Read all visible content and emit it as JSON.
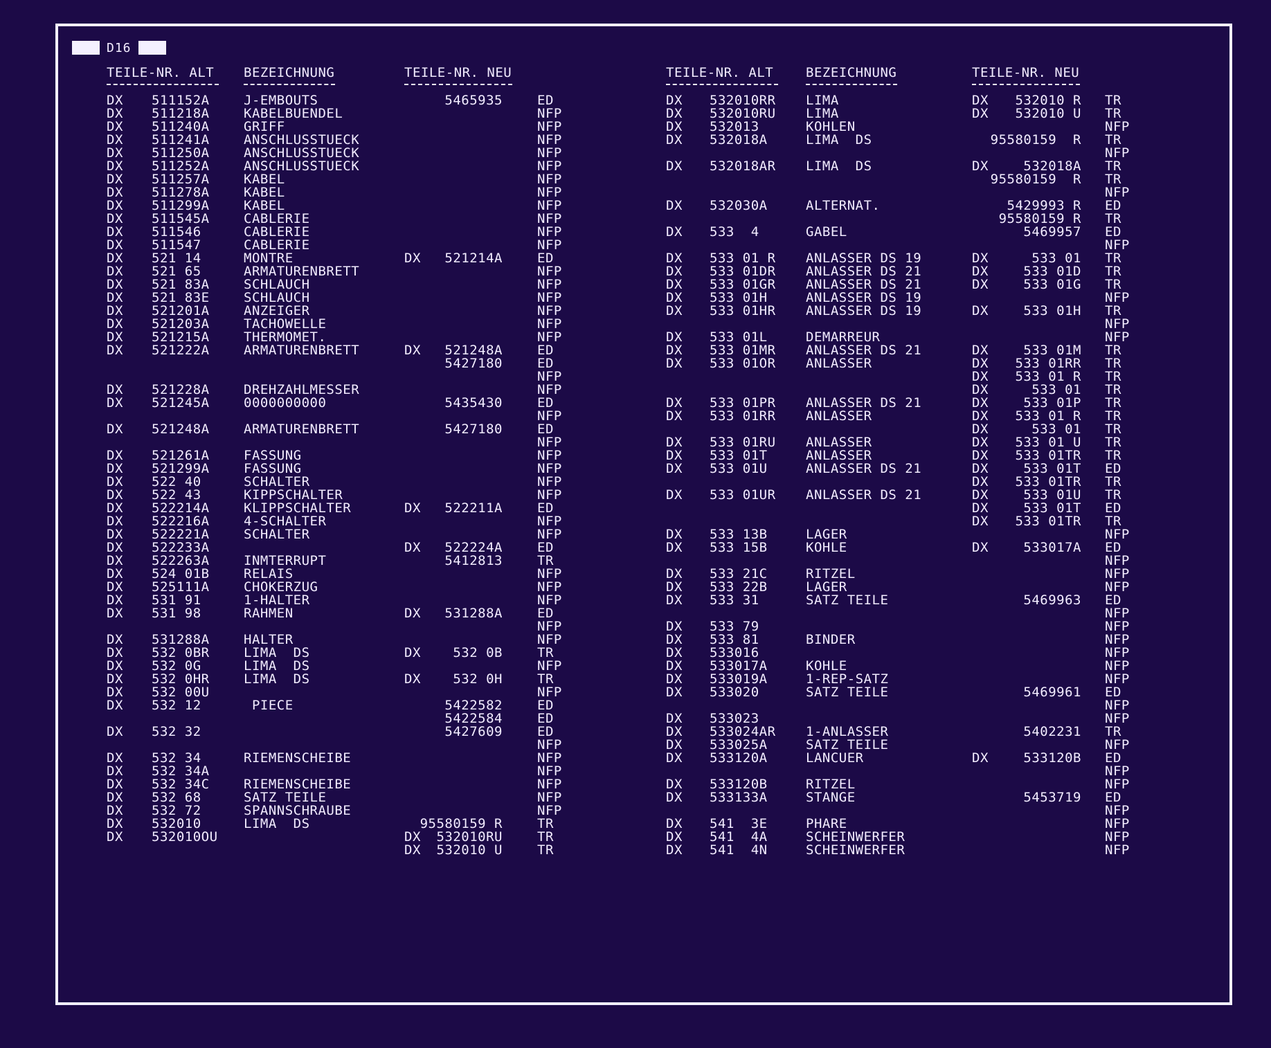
{
  "sheet_code": "D16",
  "headers": {
    "left": {
      "alt": "TEILE-NR. ALT",
      "bez": "BEZEICHNUNG",
      "neu": "TEILE-NR. NEU"
    },
    "right": {
      "alt": "TEILE-NR. ALT",
      "bez": "BEZEICHNUNG",
      "neu": "TEILE-NR. NEU"
    }
  },
  "left_rows": [
    [
      "DX",
      "511152A",
      "J-EMBOUTS",
      "",
      "5465935",
      "ED"
    ],
    [
      "DX",
      "511218A",
      "KABELBUENDEL",
      "",
      "",
      "NFP"
    ],
    [
      "DX",
      "511240A",
      "GRIFF",
      "",
      "",
      "NFP"
    ],
    [
      "DX",
      "511241A",
      "ANSCHLUSSTUECK",
      "",
      "",
      "NFP"
    ],
    [
      "DX",
      "511250A",
      "ANSCHLUSSTUECK",
      "",
      "",
      "NFP"
    ],
    [
      "DX",
      "511252A",
      "ANSCHLUSSTUECK",
      "",
      "",
      "NFP"
    ],
    [
      "DX",
      "511257A",
      "KABEL",
      "",
      "",
      "NFP"
    ],
    [
      "DX",
      "511278A",
      "KABEL",
      "",
      "",
      "NFP"
    ],
    [
      "DX",
      "511299A",
      "KABEL",
      "",
      "",
      "NFP"
    ],
    [
      "DX",
      "511545A",
      "CABLERIE",
      "",
      "",
      "NFP"
    ],
    [
      "DX",
      "511546",
      "CABLERIE",
      "",
      "",
      "NFP"
    ],
    [
      "DX",
      "511547",
      "CABLERIE",
      "",
      "",
      "NFP"
    ],
    [
      "DX",
      "521 14",
      "MONTRE",
      "DX",
      "521214A",
      "ED"
    ],
    [
      "DX",
      "521 65",
      "ARMATURENBRETT",
      "",
      "",
      "NFP"
    ],
    [
      "DX",
      "521 83A",
      "SCHLAUCH",
      "",
      "",
      "NFP"
    ],
    [
      "DX",
      "521 83E",
      "SCHLAUCH",
      "",
      "",
      "NFP"
    ],
    [
      "DX",
      "521201A",
      "ANZEIGER",
      "",
      "",
      "NFP"
    ],
    [
      "DX",
      "521203A",
      "TACHOWELLE",
      "",
      "",
      "NFP"
    ],
    [
      "DX",
      "521215A",
      "THERMOMET.",
      "",
      "",
      "NFP"
    ],
    [
      "DX",
      "521222A",
      "ARMATURENBRETT",
      "DX",
      "521248A",
      "ED"
    ],
    [
      "",
      "",
      "",
      "",
      "5427180",
      "ED"
    ],
    [
      "",
      "",
      "",
      "",
      "",
      "NFP"
    ],
    [
      "DX",
      "521228A",
      "DREHZAHLMESSER",
      "",
      "",
      "NFP"
    ],
    [
      "DX",
      "521245A",
      "0000000000",
      "",
      "5435430",
      "ED"
    ],
    [
      "",
      "",
      "",
      "",
      "",
      "NFP"
    ],
    [
      "DX",
      "521248A",
      "ARMATURENBRETT",
      "",
      "5427180",
      "ED"
    ],
    [
      "",
      "",
      "",
      "",
      "",
      "NFP"
    ],
    [
      "DX",
      "521261A",
      "FASSUNG",
      "",
      "",
      "NFP"
    ],
    [
      "DX",
      "521299A",
      "FASSUNG",
      "",
      "",
      "NFP"
    ],
    [
      "DX",
      "522 40",
      "SCHALTER",
      "",
      "",
      "NFP"
    ],
    [
      "DX",
      "522 43",
      "KIPPSCHALTER",
      "",
      "",
      "NFP"
    ],
    [
      "DX",
      "522214A",
      "KLIPPSCHALTER",
      "DX",
      "522211A",
      "ED"
    ],
    [
      "DX",
      "522216A",
      "4-SCHALTER",
      "",
      "",
      "NFP"
    ],
    [
      "DX",
      "522221A",
      "SCHALTER",
      "",
      "",
      "NFP"
    ],
    [
      "DX",
      "522233A",
      "",
      "DX",
      "522224A",
      "ED"
    ],
    [
      "DX",
      "522263A",
      "INMTERRUPT",
      "",
      "5412813",
      "TR"
    ],
    [
      "DX",
      "524 01B",
      "RELAIS",
      "",
      "",
      "NFP"
    ],
    [
      "DX",
      "525111A",
      "CHOKERZUG",
      "",
      "",
      "NFP"
    ],
    [
      "DX",
      "531 91",
      "1-HALTER",
      "",
      "",
      "NFP"
    ],
    [
      "DX",
      "531 98",
      "RAHMEN",
      "DX",
      "531288A",
      "ED"
    ],
    [
      "",
      "",
      "",
      "",
      "",
      "NFP"
    ],
    [
      "DX",
      "531288A",
      "HALTER",
      "",
      "",
      "NFP"
    ],
    [
      "DX",
      "532 0BR",
      "LIMA  DS",
      "DX",
      "532 0B",
      "TR"
    ],
    [
      "DX",
      "532 0G",
      "LIMA  DS",
      "",
      "",
      "NFP"
    ],
    [
      "DX",
      "532 0HR",
      "LIMA  DS",
      "DX",
      "532 0H",
      "TR"
    ],
    [
      "DX",
      "532 00U",
      "",
      "",
      "",
      "NFP"
    ],
    [
      "DX",
      "532 12",
      " PIECE",
      "",
      "5422582",
      "ED"
    ],
    [
      "",
      "",
      "",
      "",
      "5422584",
      "ED"
    ],
    [
      "DX",
      "532 32",
      "",
      "",
      "5427609",
      "ED"
    ],
    [
      "",
      "",
      "",
      "",
      "",
      "NFP"
    ],
    [
      "DX",
      "532 34",
      "RIEMENSCHEIBE",
      "",
      "",
      "NFP"
    ],
    [
      "DX",
      "532 34A",
      "",
      "",
      "",
      "NFP"
    ],
    [
      "DX",
      "532 34C",
      "RIEMENSCHEIBE",
      "",
      "",
      "NFP"
    ],
    [
      "DX",
      "532 68",
      "SATZ TEILE",
      "",
      "",
      "NFP"
    ],
    [
      "DX",
      "532 72",
      "SPANNSCHRAUBE",
      "",
      "",
      "NFP"
    ],
    [
      "DX",
      "532010",
      "LIMA  DS",
      "",
      "95580159 R",
      "TR"
    ],
    [
      "DX",
      "532010OU",
      "",
      "DX",
      "532010RU",
      "TR"
    ],
    [
      "",
      "",
      "",
      "DX",
      "532010 U",
      "TR"
    ]
  ],
  "right_rows": [
    [
      "DX",
      "532010RR",
      "LIMA",
      "DX",
      "532010 R",
      "TR"
    ],
    [
      "DX",
      "532010RU",
      "LIMA",
      "DX",
      "532010 U",
      "TR"
    ],
    [
      "DX",
      "532013",
      "KOHLEN",
      "",
      "",
      "NFP"
    ],
    [
      "DX",
      "532018A",
      "LIMA  DS",
      "",
      "95580159  R",
      "TR"
    ],
    [
      "",
      "",
      "",
      "",
      "",
      "NFP"
    ],
    [
      "DX",
      "532018AR",
      "LIMA  DS",
      "DX",
      "532018A",
      "TR"
    ],
    [
      "",
      "",
      "",
      "",
      "95580159  R",
      "TR"
    ],
    [
      "",
      "",
      "",
      "",
      "",
      "NFP"
    ],
    [
      "DX",
      "532030A",
      "ALTERNAT.",
      "",
      "5429993 R",
      "ED"
    ],
    [
      "",
      "",
      "",
      "",
      "95580159 R",
      "TR"
    ],
    [
      "DX",
      "533  4",
      "GABEL",
      "",
      "5469957",
      "ED"
    ],
    [
      "",
      "",
      "",
      "",
      "",
      "NFP"
    ],
    [
      "DX",
      "533 01 R",
      "ANLASSER DS 19",
      "DX",
      "533 01",
      "TR"
    ],
    [
      "DX",
      "533 01DR",
      "ANLASSER DS 21",
      "DX",
      "533 01D",
      "TR"
    ],
    [
      "DX",
      "533 01GR",
      "ANLASSER DS 21",
      "DX",
      "533 01G",
      "TR"
    ],
    [
      "DX",
      "533 01H",
      "ANLASSER DS 19",
      "",
      "",
      "NFP"
    ],
    [
      "DX",
      "533 01HR",
      "ANLASSER DS 19",
      "DX",
      "533 01H",
      "TR"
    ],
    [
      "",
      "",
      "",
      "",
      "",
      "NFP"
    ],
    [
      "DX",
      "533 01L",
      "DEMARREUR",
      "",
      "",
      "NFP"
    ],
    [
      "DX",
      "533 01MR",
      "ANLASSER DS 21",
      "DX",
      "533 01M",
      "TR"
    ],
    [
      "DX",
      "533 01OR",
      "ANLASSER",
      "DX",
      "533 01RR",
      "TR"
    ],
    [
      "",
      "",
      "",
      "DX",
      "533 01 R",
      "TR"
    ],
    [
      "",
      "",
      "",
      "DX",
      "533 01",
      "TR"
    ],
    [
      "DX",
      "533 01PR",
      "ANLASSER DS 21",
      "DX",
      "533 01P",
      "TR"
    ],
    [
      "DX",
      "533 01RR",
      "ANLASSER",
      "DX",
      "533 01 R",
      "TR"
    ],
    [
      "",
      "",
      "",
      "DX",
      "533 01",
      "TR"
    ],
    [
      "DX",
      "533 01RU",
      "ANLASSER",
      "DX",
      "533 01 U",
      "TR"
    ],
    [
      "DX",
      "533 01T",
      "ANLASSER",
      "DX",
      "533 01TR",
      "TR"
    ],
    [
      "DX",
      "533 01U",
      "ANLASSER DS 21",
      "DX",
      "533 01T",
      "ED"
    ],
    [
      "",
      "",
      "",
      "DX",
      "533 01TR",
      "TR"
    ],
    [
      "DX",
      "533 01UR",
      "ANLASSER DS 21",
      "DX",
      "533 01U",
      "TR"
    ],
    [
      "",
      "",
      "",
      "DX",
      "533 01T",
      "ED"
    ],
    [
      "",
      "",
      "",
      "DX",
      "533 01TR",
      "TR"
    ],
    [
      "DX",
      "533 13B",
      "LAGER",
      "",
      "",
      "NFP"
    ],
    [
      "DX",
      "533 15B",
      "KOHLE",
      "DX",
      "533017A",
      "ED"
    ],
    [
      "",
      "",
      "",
      "",
      "",
      "NFP"
    ],
    [
      "DX",
      "533 21C",
      "RITZEL",
      "",
      "",
      "NFP"
    ],
    [
      "DX",
      "533 22B",
      "LAGER",
      "",
      "",
      "NFP"
    ],
    [
      "DX",
      "533 31",
      "SATZ TEILE",
      "",
      "5469963",
      "ED"
    ],
    [
      "",
      "",
      "",
      "",
      "",
      "NFP"
    ],
    [
      "DX",
      "533 79",
      "",
      "",
      "",
      "NFP"
    ],
    [
      "DX",
      "533 81",
      "BINDER",
      "",
      "",
      "NFP"
    ],
    [
      "DX",
      "533016",
      "",
      "",
      "",
      "NFP"
    ],
    [
      "DX",
      "533017A",
      "KOHLE",
      "",
      "",
      "NFP"
    ],
    [
      "DX",
      "533019A",
      "1-REP-SATZ",
      "",
      "",
      "NFP"
    ],
    [
      "DX",
      "533020",
      "SATZ TEILE",
      "",
      "5469961",
      "ED"
    ],
    [
      "",
      "",
      "",
      "",
      "",
      "NFP"
    ],
    [
      "DX",
      "533023",
      "",
      "",
      "",
      "NFP"
    ],
    [
      "DX",
      "533024AR",
      "1-ANLASSER",
      "",
      "5402231",
      "TR"
    ],
    [
      "DX",
      "533025A",
      "SATZ TEILE",
      "",
      "",
      "NFP"
    ],
    [
      "DX",
      "533120A",
      "LANCUER",
      "DX",
      "533120B",
      "ED"
    ],
    [
      "",
      "",
      "",
      "",
      "",
      "NFP"
    ],
    [
      "DX",
      "533120B",
      "RITZEL",
      "",
      "",
      "NFP"
    ],
    [
      "DX",
      "533133A",
      "STANGE",
      "",
      "5453719",
      "ED"
    ],
    [
      "",
      "",
      "",
      "",
      "",
      "NFP"
    ],
    [
      "DX",
      "541  3E",
      "PHARE",
      "",
      "",
      "NFP"
    ],
    [
      "DX",
      "541  4A",
      "SCHEINWERFER",
      "",
      "",
      "NFP"
    ],
    [
      "DX",
      "541  4N",
      "SCHEINWERFER",
      "",
      "",
      "NFP"
    ]
  ]
}
